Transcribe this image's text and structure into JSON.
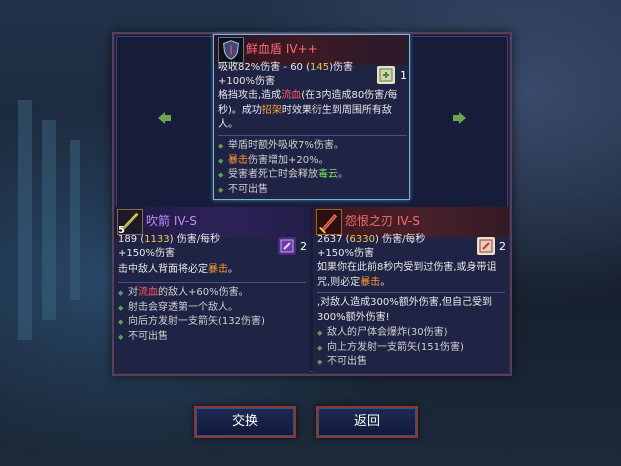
{
  "center_item": {
    "name": "鲜血盾",
    "tier": "IV++",
    "stat_prefix": "吸收82%伤害 - 60 (",
    "stat_highlight": "145",
    "stat_suffix": ")伤害",
    "bonus": "+100%伤害",
    "scroll_count": "1",
    "desc_line1_a": "格挡攻击,造成",
    "desc_line1_b": "流血",
    "desc_line1_c": "(在3内造成80伤害/每",
    "desc_line2_a": "秒)。成功",
    "desc_line2_b": "招架",
    "desc_line2_c": "时效果衍生到周围所有敌",
    "desc_line3": "人。",
    "affix1": "举盾时额外吸收7%伤害。",
    "affix2_a": "暴击",
    "affix2_b": "伤害增加+20%。",
    "affix3_a": "受害者死亡时会释放",
    "affix3_b": "毒云",
    "affix3_c": "。",
    "affix4": "不可出售"
  },
  "left_item": {
    "name": "吹箭",
    "tier": "IV-S",
    "level": "5",
    "stat_a": "189 (",
    "stat_highlight": "1133",
    "stat_b": ") 伤害/每秒",
    "bonus": "+150%伤害",
    "scroll_count": "2",
    "desc_a": "击中敌人背面将必定",
    "desc_b": "暴击",
    "desc_c": "。",
    "affix1_a": "对",
    "affix1_b": "流血",
    "affix1_c": "的敌人+60%伤害。",
    "affix2": "射击会穿透第一个敌人。",
    "affix3": "向后方发射一支箭矢(132伤害)",
    "affix4": "不可出售"
  },
  "right_item": {
    "name": "怨恨之刃",
    "tier": "IV-S",
    "stat_a": "2637 (",
    "stat_highlight": "6330",
    "stat_b": ") 伤害/每秒",
    "bonus": "+150%伤害",
    "scroll_count": "2",
    "desc_line1": "如果你在此前8秒内受到过伤害,或身带诅",
    "desc_line2_a": "咒,则必定",
    "desc_line2_b": "暴击",
    "desc_line2_c": "。",
    "curse_line1": ",对敌人造成300%额外伤害,但自己受到",
    "curse_line2": "300%额外伤害!",
    "affix1": "敌人的尸体会爆炸(30伤害)",
    "affix2": "向上方发射一支箭矢(151伤害)",
    "affix3": "不可出售"
  },
  "buttons": {
    "swap": "交换",
    "back": "返回"
  },
  "colors": {
    "highlight_yellow": "#f2c84a",
    "red_text": "#ff5a5a",
    "orange_text": "#ff9a30",
    "curse_green": "#78e85a",
    "button_border": "#8a3a2c"
  }
}
